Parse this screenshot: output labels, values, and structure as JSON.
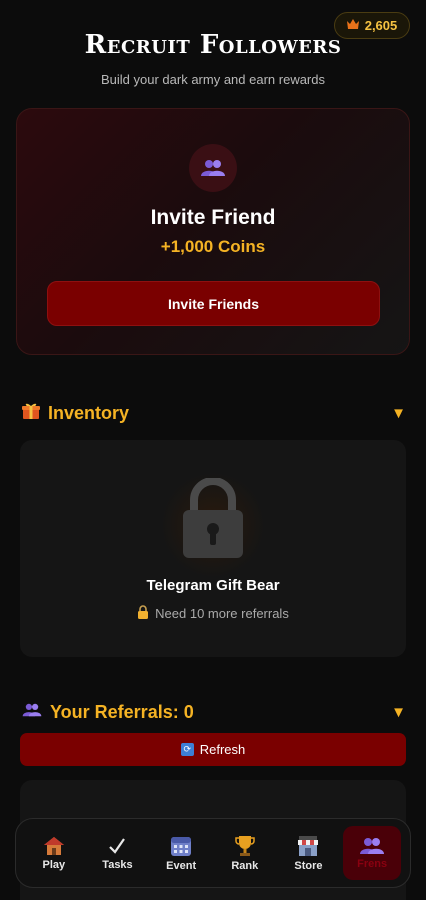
{
  "header": {
    "coins": "2,605",
    "coin_icon": "crown-icon",
    "title": "Recruit Followers",
    "subtitle": "Build your dark army and earn rewards"
  },
  "invite": {
    "icon": "users-icon",
    "title": "Invite Friend",
    "reward": "+1,000 Coins",
    "button_label": "Invite Friends"
  },
  "inventory": {
    "icon": "gift-icon",
    "title": "Inventory",
    "toggle": "▼",
    "item_name": "Telegram Gift Bear",
    "requirement": "Need 10 more referrals"
  },
  "referrals": {
    "icon": "users-icon",
    "title": "Your Referrals: 0",
    "toggle": "▼",
    "refresh_label": "Refresh"
  },
  "nav": [
    {
      "label": "Play",
      "icon": "house-icon"
    },
    {
      "label": "Tasks",
      "icon": "checkmark-icon"
    },
    {
      "label": "Event",
      "icon": "calendar-icon"
    },
    {
      "label": "Rank",
      "icon": "trophy-icon"
    },
    {
      "label": "Store",
      "icon": "store-icon"
    },
    {
      "label": "Frens",
      "icon": "users-icon",
      "active": true
    }
  ],
  "colors": {
    "accent": "#f5b324",
    "button": "#7a0000",
    "background": "#0c0c0c"
  }
}
